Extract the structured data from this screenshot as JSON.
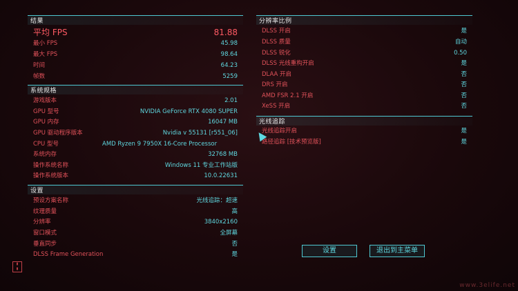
{
  "results": {
    "title": "结果",
    "rows": [
      {
        "k": "平均 FPS",
        "v": "81.88"
      },
      {
        "k": "最小 FPS",
        "v": "45.98"
      },
      {
        "k": "最大 FPS",
        "v": "98.64"
      },
      {
        "k": "时间",
        "v": "64.23"
      },
      {
        "k": "帧数",
        "v": "5259"
      }
    ]
  },
  "specs": {
    "title": "系统规格",
    "rows": [
      {
        "k": "游戏版本",
        "v": "2.01"
      },
      {
        "k": "GPU 型号",
        "v": "NVIDIA GeForce RTX 4080 SUPER"
      },
      {
        "k": "GPU 内存",
        "v": "16047 MB"
      },
      {
        "k": "GPU 驱动程序版本",
        "v": "Nvidia v 55131 [r551_06]"
      },
      {
        "k": "CPU 型号",
        "v": "AMD Ryzen 9 7950X 16-Core Processor"
      },
      {
        "k": "系统内存",
        "v": "32768 MB"
      },
      {
        "k": "操作系统名称",
        "v": "Windows 11 专业工作站版"
      },
      {
        "k": "操作系统版本",
        "v": "10.0.22631"
      }
    ]
  },
  "settings": {
    "title": "设置",
    "rows": [
      {
        "k": "预设方案名称",
        "v": "光线追踪：超速"
      },
      {
        "k": "纹理质量",
        "v": "高"
      },
      {
        "k": "分辨率",
        "v": "3840x2160"
      },
      {
        "k": "窗口模式",
        "v": "全屏幕"
      },
      {
        "k": "垂直同步",
        "v": "否"
      },
      {
        "k": "DLSS Frame Generation",
        "v": "是"
      }
    ]
  },
  "resolution": {
    "title": "分辨率比例",
    "rows": [
      {
        "k": "DLSS 开启",
        "v": "是"
      },
      {
        "k": "DLSS 质量",
        "v": "自动"
      },
      {
        "k": "DLSS 锐化",
        "v": "0.50"
      },
      {
        "k": "DLSS 光线重构开启",
        "v": "是"
      },
      {
        "k": "DLAA 开启",
        "v": "否"
      },
      {
        "k": "DRS 开启",
        "v": "否"
      },
      {
        "k": "AMD FSR 2.1 开启",
        "v": "否"
      },
      {
        "k": "XeSS 开启",
        "v": "否"
      }
    ]
  },
  "raytracing": {
    "title": "光线追踪",
    "rows": [
      {
        "k": "光线追踪开启",
        "v": "是"
      },
      {
        "k": "路径追踪 [技术预览版]",
        "v": "是"
      }
    ]
  },
  "buttons": {
    "settings": "设置",
    "exit": "退出到主菜单"
  },
  "watermark": "www.3elife.net"
}
